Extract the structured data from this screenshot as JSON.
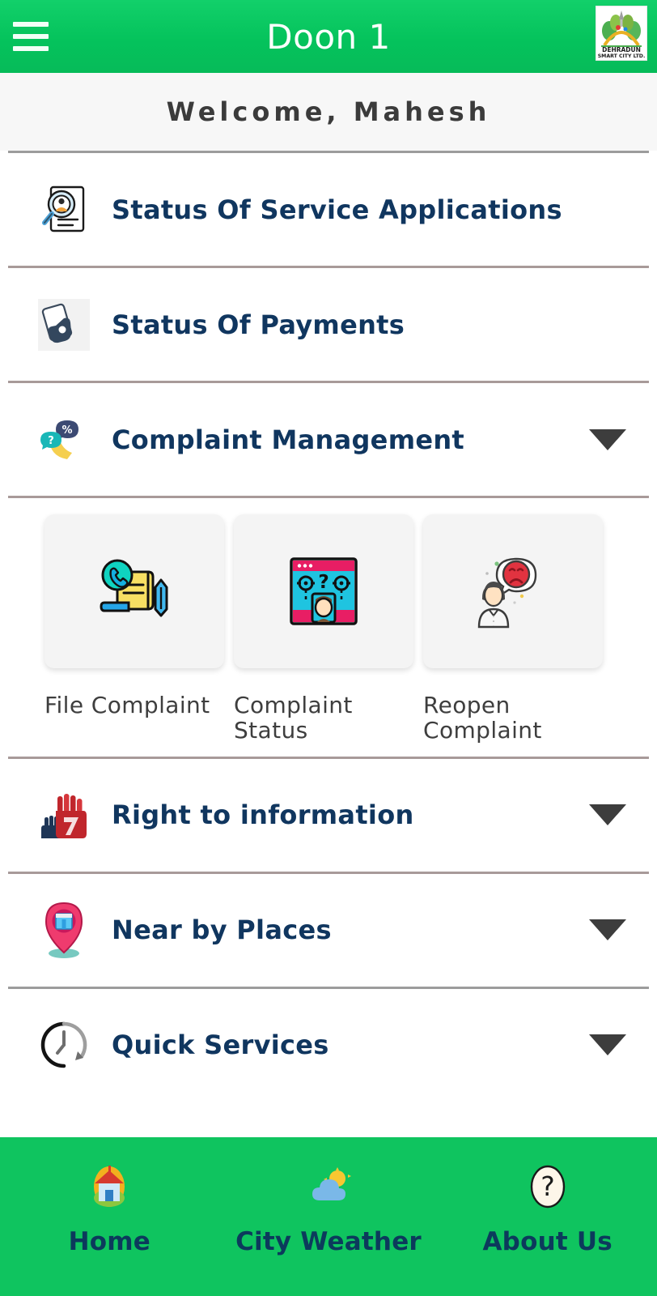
{
  "header": {
    "title": "Doon 1",
    "menu_icon": "hamburger-menu-icon",
    "logo_line1": "DEHRADUN",
    "logo_line2": "SMART CITY LTD.",
    "logo_alt": "dehradun-smart-city-logo"
  },
  "welcome": {
    "text": "Welcome, Mahesh"
  },
  "menu": [
    {
      "label": "Status Of Service Applications",
      "icon": "document-person-search-icon",
      "expandable": false
    },
    {
      "label": "Status Of Payments",
      "icon": "hand-card-tap-icon",
      "expandable": false
    },
    {
      "label": "Complaint Management",
      "icon": "complaint-chat-phone-icon",
      "expandable": true,
      "expanded": true
    },
    {
      "label": "Right to information",
      "icon": "raised-fists-icon",
      "expandable": true,
      "expanded": false
    },
    {
      "label": "Near by Places",
      "icon": "map-pin-building-icon",
      "expandable": true,
      "expanded": false
    },
    {
      "label": "Quick Services",
      "icon": "clock-history-icon",
      "expandable": true,
      "expanded": false
    }
  ],
  "complaint_cards": [
    {
      "label": "File Complaint",
      "icon": "phone-document-pencil-icon"
    },
    {
      "label": "Complaint Status",
      "icon": "browser-person-question-icon"
    },
    {
      "label": "Reopen Complaint",
      "icon": "person-sad-face-bubble-icon"
    }
  ],
  "bottom_nav": [
    {
      "label": "Home",
      "icon": "home-house-icon",
      "active": true
    },
    {
      "label": "City Weather",
      "icon": "cloud-sun-icon",
      "active": false
    },
    {
      "label": "About Us",
      "icon": "question-mark-icon",
      "active": false
    }
  ],
  "colors": {
    "header_green": "#06bb59",
    "nav_green": "#0fc45f",
    "heading_navy": "#10365f",
    "label_gray": "#3e3e3e",
    "tile_gray": "#f4f4f4"
  }
}
